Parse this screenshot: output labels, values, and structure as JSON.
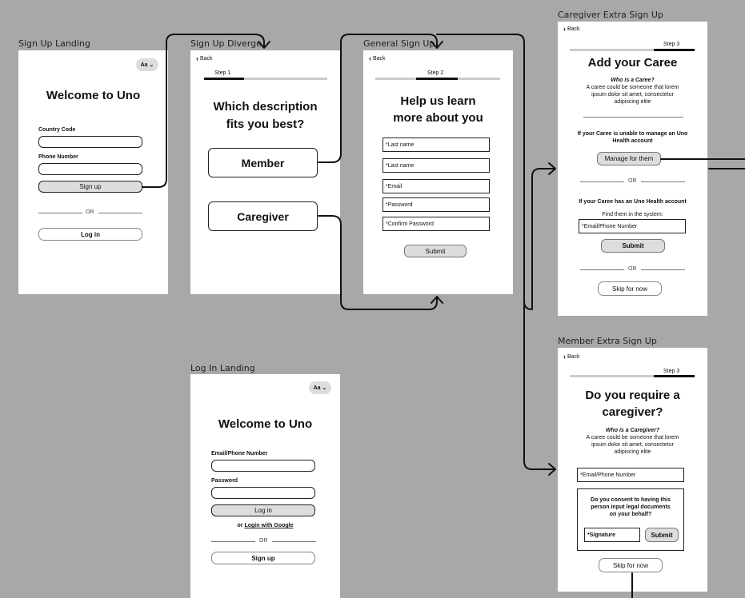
{
  "frames": {
    "signup_landing": {
      "label": "Sign Up Landing",
      "font_toggle": "Aa ⌄",
      "title": "Welcome to Uno",
      "country_code_label": "Country Code",
      "phone_label": "Phone Number",
      "signup_button": "Sign up",
      "or": "OR",
      "login_button": "Log in"
    },
    "signup_diverge": {
      "label": "Sign Up Diverge",
      "back": "Back",
      "step": "Step 1",
      "title_line1": "Which description",
      "title_line2": "fits you best?",
      "member": "Member",
      "caregiver": "Caregiver"
    },
    "general_signup": {
      "label": "General Sign Up",
      "back": "Back",
      "step": "Step 2",
      "title_line1": "Help us learn",
      "title_line2": "more about you",
      "fields": [
        "*Last name",
        "*Last name",
        "*Email",
        "*Password",
        "*Confirm Password"
      ],
      "submit": "Submit"
    },
    "caregiver_extra": {
      "label": "Caregiver Extra Sign Up",
      "back": "Back",
      "step": "Step 3",
      "title": "Add your Caree",
      "who_heading": "Who is a Caree?",
      "who_line1": "A caree could be someone that lorem",
      "who_line2": "ipsum dolor sit amet, consectetur",
      "who_line3": "adipiscing elite",
      "unable_line1": "If your Caree is unable to manage an Uno",
      "unable_line2": "Health account",
      "manage_button": "Manage for them",
      "or1": "OR",
      "has_account": "If your Caree has an Uno Health account",
      "find_text": "Find them in the system:",
      "email_phone": "*Email/Phone Number",
      "submit": "Submit",
      "or2": "OR",
      "skip": "Skip for now"
    },
    "member_extra": {
      "label": "Member Extra Sign Up",
      "back": "Back",
      "step": "Step 3",
      "title_line1": "Do you require a",
      "title_line2": "caregiver?",
      "who_heading": "Who is a Caregiver?",
      "who_line1": "A caree could be someone that lorem",
      "who_line2": "ipsum dolor sit amet, consectetur",
      "who_line3": "adipiscing elite",
      "email_phone": "*Email/Phone Number",
      "consent_line1": "Do you consent to having this",
      "consent_line2": "person input legal documents",
      "consent_line3": "on your behalf?",
      "signature": "*Signature",
      "submit": "Submit",
      "skip": "Skip for now"
    },
    "login_landing": {
      "label": "Log In Landing",
      "font_toggle": "Aa ⌄",
      "title": "Welcome to Uno",
      "email_label": "Email/Phone Number",
      "password_label": "Password",
      "login_button": "Log in",
      "or_prefix": "or",
      "google_link": "Login with Google",
      "or": "OR",
      "signup_button": "Sign up"
    }
  },
  "colors": {
    "canvas": "#a8a8a8",
    "frame": "#ffffff",
    "connector": "#111111",
    "button_fill": "#dddddd"
  }
}
